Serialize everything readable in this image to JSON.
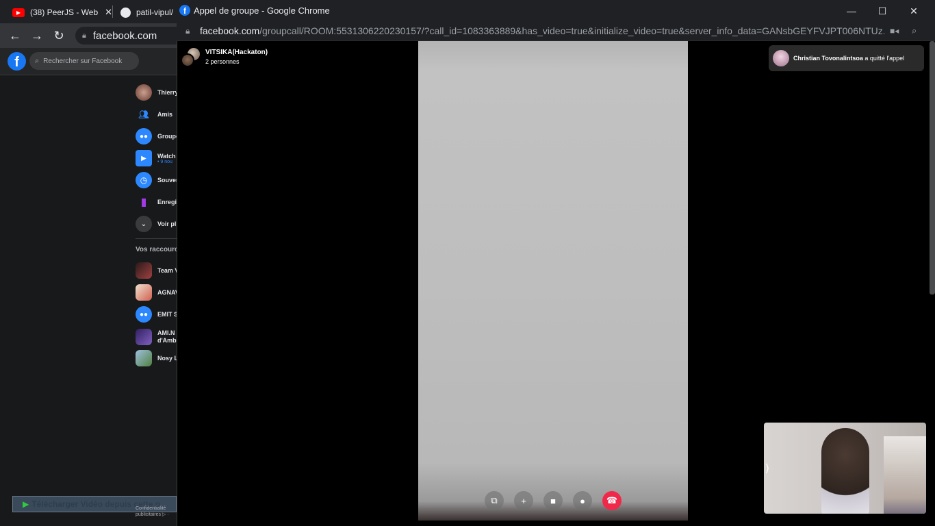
{
  "background_browser": {
    "tabs": [
      {
        "icon": "youtube-icon",
        "label": "(38) PeerJS - Web"
      },
      {
        "icon": "github-icon",
        "label": "patil-vipul/"
      }
    ],
    "address": "facebook.com"
  },
  "facebook": {
    "search_placeholder": "Rechercher sur Facebook",
    "sidebar": [
      {
        "icon": "profile-avatar",
        "label": "Thierry"
      },
      {
        "icon": "friends-icon",
        "label": "Amis"
      },
      {
        "icon": "groups-icon",
        "label": "Groupe"
      },
      {
        "icon": "watch-icon",
        "label": "Watch",
        "sub": "• 9 nou"
      },
      {
        "icon": "memories-icon",
        "label": "Souven"
      },
      {
        "icon": "saved-icon",
        "label": "Enregis"
      },
      {
        "icon": "chevron-down-icon",
        "label": "Voir pl"
      }
    ],
    "shortcuts_title": "Vos raccourc",
    "shortcuts": [
      {
        "label": "Team V"
      },
      {
        "label": "AGNAV"
      },
      {
        "label": "EMIT S"
      },
      {
        "label": "AMI.N",
        "sub": "d'Amb"
      },
      {
        "label": "Nosy L"
      }
    ],
    "privacy_line1": "Confidentialité",
    "privacy_line2": "publicitaires ▷ ·",
    "download_bar_label": "Télécharger Vidéo depuis cette p"
  },
  "call_window": {
    "title": "Appel de groupe - Google Chrome",
    "url_host": "facebook.com",
    "url_path": "/groupcall/ROOM:5531306220230157/?call_id=1083363889&has_video=true&initialize_video=true&server_info_data=GANsbGEYFVJPT006NTUz...",
    "group_name": "VITSIKA(Hackaton)",
    "participants": "2 personnes",
    "toast_name": "Christian Tovonalintsoa",
    "toast_action": " a quitté l'appel",
    "controls": [
      {
        "name": "share-screen-button",
        "glyph": "⧉"
      },
      {
        "name": "add-person-button",
        "glyph": "+"
      },
      {
        "name": "video-toggle-button",
        "glyph": "■"
      },
      {
        "name": "mic-toggle-button",
        "glyph": "●"
      },
      {
        "name": "end-call-button",
        "glyph": "☎"
      }
    ],
    "self_view_toggle": "⟩"
  },
  "colors": {
    "facebook_blue": "#1877f2",
    "end_call_red": "#f02849"
  }
}
